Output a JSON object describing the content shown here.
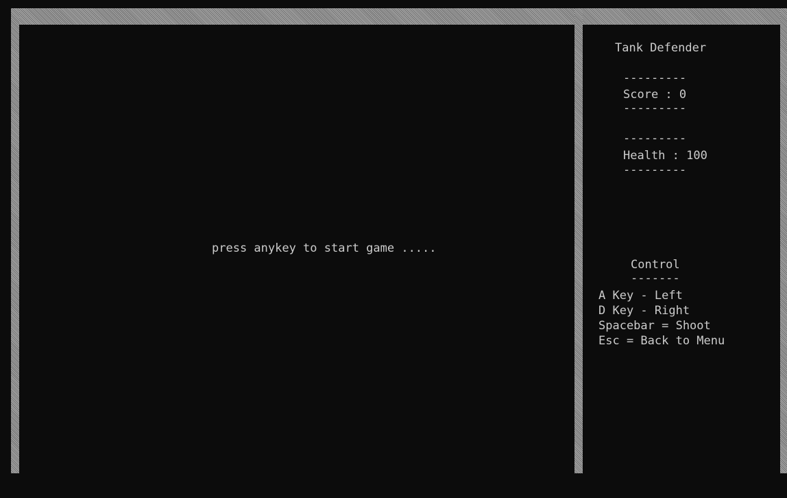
{
  "game": {
    "prompt": "press anykey to start game ....."
  },
  "sidebar": {
    "title": "Tank Defender",
    "divider": "---------",
    "score_text": "Score : 0",
    "health_text": "Health : 100",
    "control_title": "Control",
    "control_divider": "-------",
    "controls": [
      "A Key - Left",
      "D Key - Right",
      "Spacebar = Shoot",
      "Esc = Back to Menu"
    ]
  },
  "colors": {
    "background": "#0c0c0c",
    "text": "#cccccc",
    "wall": "#8a8a8a"
  }
}
